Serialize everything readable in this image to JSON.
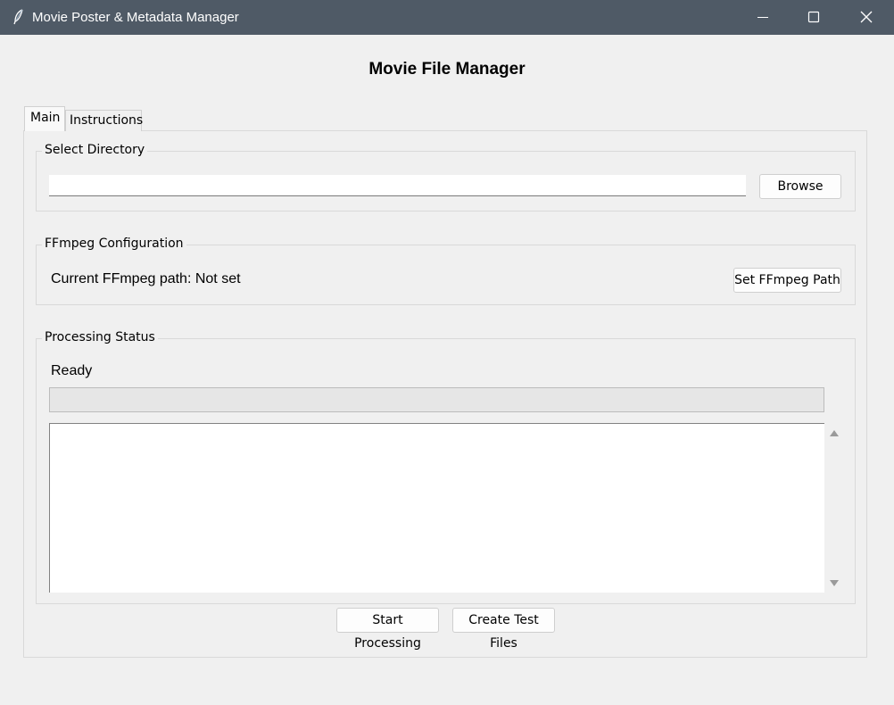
{
  "window": {
    "title": "Movie Poster & Metadata Manager",
    "icon": "feather-icon",
    "controls": [
      "minimize-icon",
      "maximize-icon",
      "close-icon"
    ]
  },
  "heading": "Movie File Manager",
  "tabs": [
    {
      "label": "Main",
      "selected": true
    },
    {
      "label": "Instructions",
      "selected": false
    }
  ],
  "directory": {
    "group_label": "Select Directory",
    "input_value": "",
    "browse_label": "Browse"
  },
  "ffmpeg": {
    "group_label": "FFmpeg Configuration",
    "path_text": "Current FFmpeg path: Not set",
    "set_path_label": "Set FFmpeg Path"
  },
  "processing": {
    "group_label": "Processing Status",
    "status": "Ready",
    "progress": 0,
    "log_text": ""
  },
  "actions": {
    "start_label": "Start Processing",
    "test_files_label": "Create Test Files"
  }
}
